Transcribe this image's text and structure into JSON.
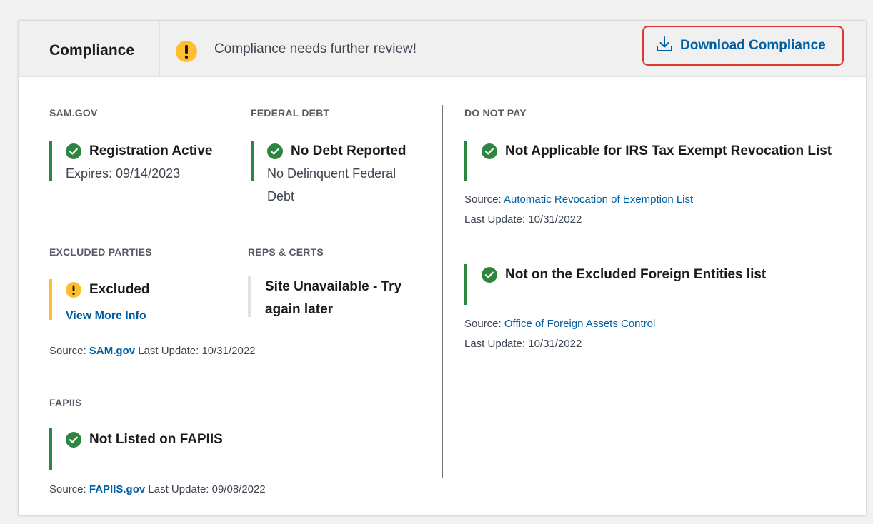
{
  "header": {
    "title": "Compliance",
    "message": "Compliance needs further review!",
    "download_label": "Download Compliance"
  },
  "sam": {
    "heading": "SAM.GOV",
    "status": "Registration Active",
    "detail": "Expires: 09/14/2023"
  },
  "federal_debt": {
    "heading": "FEDERAL DEBT",
    "status": "No Debt Reported",
    "detail_line1": "No Delinquent Federal",
    "detail_line2": "Debt"
  },
  "excluded": {
    "heading": "EXCLUDED PARTIES",
    "status": "Excluded",
    "link": "View More Info"
  },
  "reps": {
    "heading": "REPS & CERTS",
    "line1": "Site Unavailable - Try",
    "line2": "again later"
  },
  "sam_source": {
    "label": "Source:",
    "link": "SAM.gov",
    "update": "Last Update: 10/31/2022"
  },
  "fapiis": {
    "heading": "FAPIIS",
    "status": "Not Listed on FAPIIS",
    "source_label": "Source:",
    "source_link": "FAPIIS.gov",
    "update": "Last Update: 09/08/2022"
  },
  "do_not_pay": {
    "heading": "DO NOT PAY",
    "item1": {
      "status": "Not Applicable for IRS Tax Exempt Revocation List",
      "source_label": "Source:",
      "source_link": "Automatic Revocation of Exemption List",
      "update": "Last Update: 10/31/2022"
    },
    "item2": {
      "status": "Not on the Excluded Foreign Entities list",
      "source_label": "Source:",
      "source_link": "Office of Foreign Assets Control",
      "update": "Last Update: 10/31/2022"
    }
  },
  "colors": {
    "success": "#2e8540",
    "warning": "#ffbe2e",
    "link": "#005ea2",
    "highlight": "#d83933"
  }
}
